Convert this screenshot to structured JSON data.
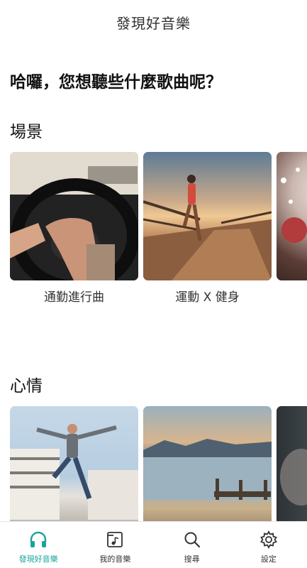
{
  "header": {
    "title": "發現好音樂"
  },
  "greeting": "哈囉，您想聽些什麼歌曲呢？",
  "sections": {
    "scene": {
      "title": "場景",
      "cards": [
        {
          "label": "通勤進行曲"
        },
        {
          "label": "運動 X 健身"
        },
        {
          "label": ""
        }
      ]
    },
    "mood": {
      "title": "心情",
      "cards": [
        {
          "label": ""
        },
        {
          "label": ""
        },
        {
          "label": ""
        }
      ]
    }
  },
  "tabbar": {
    "active_color": "#19a39b",
    "items": [
      {
        "label": "發現好音樂",
        "icon": "headphones-icon",
        "active": true
      },
      {
        "label": "我的音樂",
        "icon": "music-folder-icon",
        "active": false
      },
      {
        "label": "搜尋",
        "icon": "search-icon",
        "active": false
      },
      {
        "label": "設定",
        "icon": "gear-icon",
        "active": false
      }
    ]
  }
}
